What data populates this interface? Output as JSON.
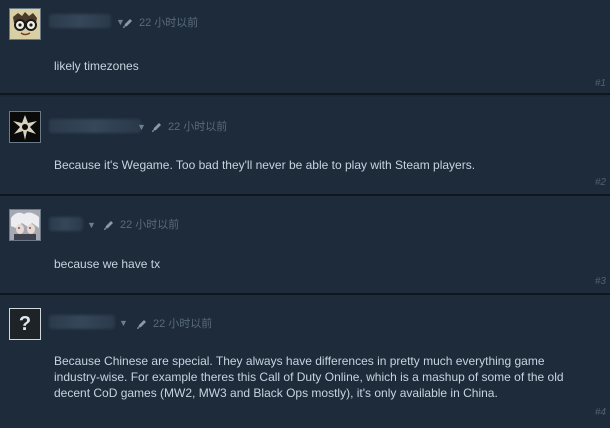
{
  "comments": [
    {
      "avatar_icon": "glasses-cartoon-avatar",
      "time": "22 小时以前",
      "text": "likely timezones",
      "number": "#1"
    },
    {
      "avatar_icon": "dark-emblem-avatar",
      "time": "22 小时以前",
      "text": "Because it's Wegame. Too bad they'll never be able to play with Steam players.",
      "number": "#2"
    },
    {
      "avatar_icon": "anime-character-avatar",
      "time": "22 小时以前",
      "text": "because we have tx",
      "number": "#3"
    },
    {
      "avatar_icon": "question-mark-avatar",
      "avatar_glyph": "?",
      "time": "22 小时以前",
      "text": "Because Chinese are special. They always have differences in pretty much everything game industry-wise. For example theres this Call of Duty Online, which is a mashup of some of the old decent CoD games (MW2, MW3 and Black Ops mostly), it's only available in China.",
      "number": "#4"
    }
  ]
}
